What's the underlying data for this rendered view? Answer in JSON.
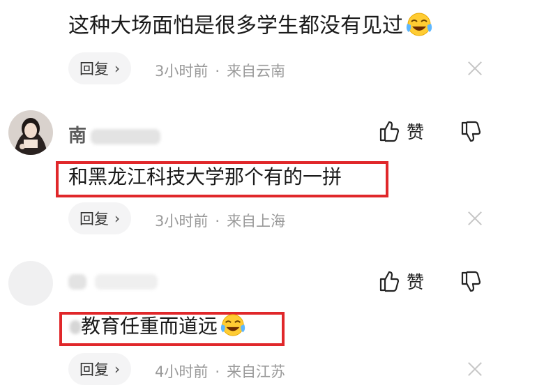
{
  "comments": [
    {
      "content": "这种大场面怕是很多学生都没有见过",
      "emoji": "laughing-crying-emoji",
      "reply_label": "回复",
      "time": "3小时前",
      "location": "来自云南"
    },
    {
      "username": "南",
      "content": "和黑龙江科技大学那个有的一拼",
      "like_label": "赞",
      "reply_label": "回复",
      "time": "3小时前",
      "location": "来自上海"
    },
    {
      "username": "",
      "content": "教育任重而道远",
      "emoji": "laughing-crying-emoji",
      "like_label": "赞",
      "reply_label": "回复",
      "time": "4小时前",
      "location": "来自江苏"
    }
  ],
  "separator": "·",
  "colors": {
    "highlight": "#e0272a",
    "meta": "#9a9a9a",
    "pill": "#f4f4f5"
  }
}
